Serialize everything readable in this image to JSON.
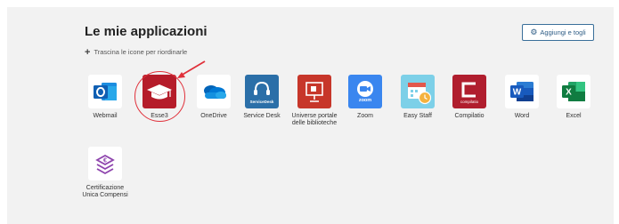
{
  "header": {
    "title": "Le mie applicazioni",
    "hint": "Trascina le icone per riordinarle",
    "manage_button": "Aggiungi e togli"
  },
  "apps": [
    {
      "label": "Webmail",
      "icon": "outlook-icon",
      "color": "#ffffff"
    },
    {
      "label": "Esse3",
      "icon": "graduation-cap-icon",
      "color": "#b51c2a"
    },
    {
      "label": "OneDrive",
      "icon": "cloud-icon",
      "color": "#ffffff"
    },
    {
      "label": "Service Desk",
      "icon": "headset-icon",
      "color": "#2b6fa8",
      "sublabel": "ServiceDesk"
    },
    {
      "label": "Universe portale delle biblioteche",
      "icon": "presentation-icon",
      "color": "#c7362a"
    },
    {
      "label": "Zoom",
      "icon": "video-camera-icon",
      "color": "#3a86ef",
      "sublabel": "zoom"
    },
    {
      "label": "Easy Staff",
      "icon": "calendar-clock-icon",
      "color": "#7dd0e8"
    },
    {
      "label": "Compilatio",
      "icon": "compilatio-icon",
      "color": "#b01e2e",
      "sublabel": "compilatio"
    },
    {
      "label": "Word",
      "icon": "word-icon",
      "color": "#ffffff"
    },
    {
      "label": "Excel",
      "icon": "excel-icon",
      "color": "#ffffff"
    },
    {
      "label": "Certificazione Unica Compensi",
      "icon": "euro-stack-icon",
      "color": "#ffffff"
    }
  ],
  "colors": {
    "highlight": "#e0303a",
    "button_border": "#3a6f9a"
  }
}
